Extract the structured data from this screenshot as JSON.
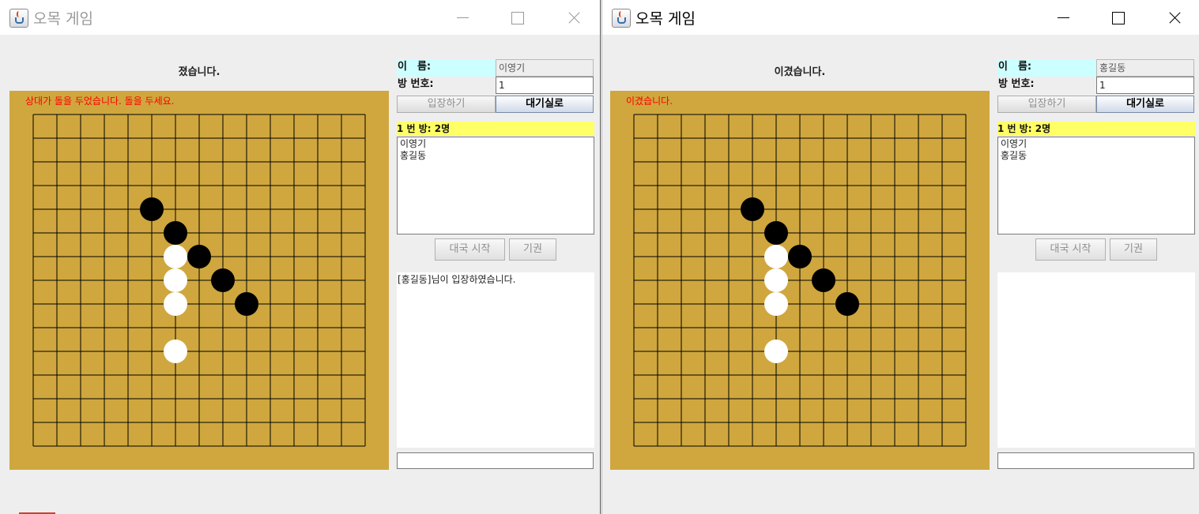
{
  "windows": [
    {
      "title": "오목 게임",
      "status": "졌습니다.",
      "board_message": "상대가 돌을 두었습니다. 돌을 두세요.",
      "name_label": "이　름:",
      "name_value": "이영기",
      "room_label": "방 번호:",
      "room_value": "1",
      "enter_button": "입장하기",
      "lobby_button": "대기실로",
      "room_header": "1 번 방: 2명",
      "players": [
        "이영기",
        "홍길동"
      ],
      "start_button": "대국 시작",
      "resign_button": "기권",
      "chat_lines": [
        "[홍길동]님이 입장하였습니다."
      ],
      "chat_input": ""
    },
    {
      "title": "오목 게임",
      "status": "이겼습니다.",
      "board_message": "이겼습니다.",
      "name_label": "이　름:",
      "name_value": "홍길동",
      "room_label": "방 번호:",
      "room_value": "1",
      "enter_button": "입장하기",
      "lobby_button": "대기실로",
      "room_header": "1 번 방: 2명",
      "players": [
        "이영기",
        "홍길동"
      ],
      "start_button": "대국 시작",
      "resign_button": "기권",
      "chat_lines": [],
      "chat_input": ""
    }
  ],
  "board": {
    "grid_lines": 15,
    "board_color": "#cfa73e",
    "line_color": "#000000",
    "stones": [
      {
        "col": 5,
        "row": 4,
        "color": "black"
      },
      {
        "col": 6,
        "row": 5,
        "color": "black"
      },
      {
        "col": 7,
        "row": 6,
        "color": "black"
      },
      {
        "col": 8,
        "row": 7,
        "color": "black"
      },
      {
        "col": 9,
        "row": 8,
        "color": "black"
      },
      {
        "col": 6,
        "row": 6,
        "color": "white"
      },
      {
        "col": 6,
        "row": 7,
        "color": "white"
      },
      {
        "col": 6,
        "row": 8,
        "color": "white"
      },
      {
        "col": 6,
        "row": 10,
        "color": "white"
      }
    ]
  },
  "colors": {
    "status_message": "#ff0000",
    "name_label_bg": "#ccffff",
    "room_header_bg": "#ffff66"
  }
}
